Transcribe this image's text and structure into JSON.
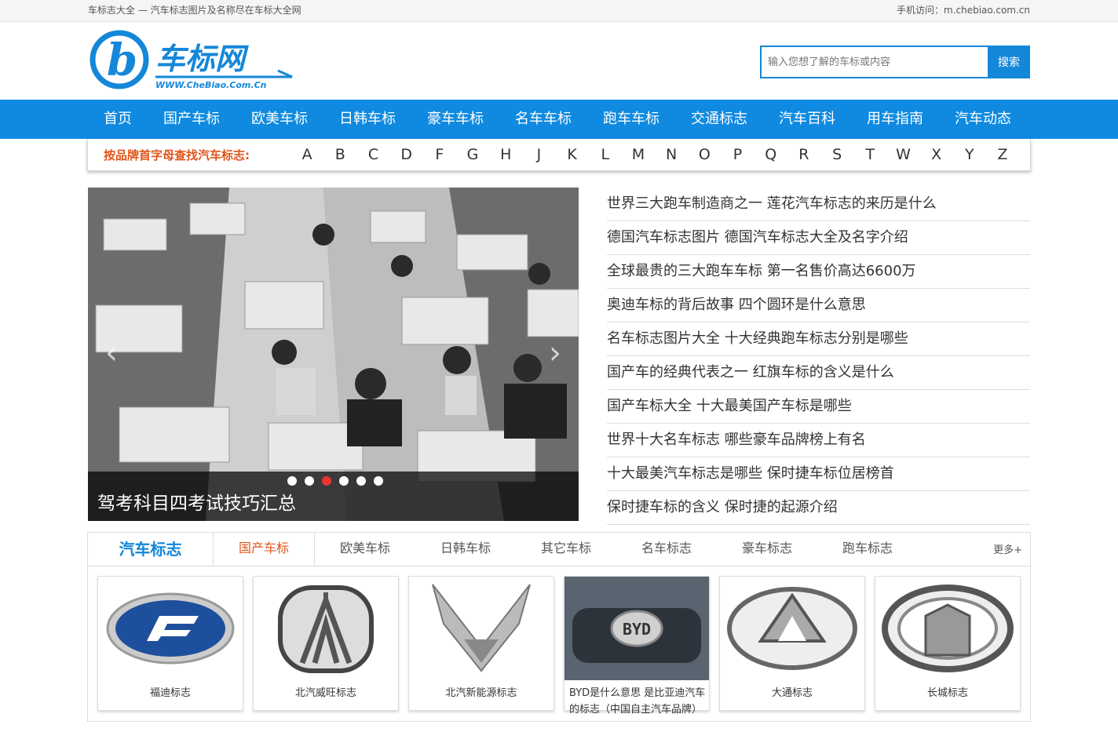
{
  "topbar": {
    "left": "车标志大全 — 汽车标志图片及名称尽在车标大全网",
    "right": "手机访问：m.chebiao.com.cn"
  },
  "logo": {
    "text": "车标网",
    "url": "WWW.CheBiao.Com.Cn"
  },
  "search": {
    "placeholder": "输入您想了解的车标或内容",
    "button": "搜索"
  },
  "nav": [
    "首页",
    "国产车标",
    "欧美车标",
    "日韩车标",
    "豪车车标",
    "名车车标",
    "跑车车标",
    "交通标志",
    "汽车百科",
    "用车指南",
    "汽车动态"
  ],
  "letters": {
    "label": "按品牌首字母查找汽车标志:",
    "items": [
      "A",
      "B",
      "C",
      "D",
      "F",
      "G",
      "H",
      "J",
      "K",
      "L",
      "M",
      "N",
      "O",
      "P",
      "Q",
      "R",
      "S",
      "T",
      "W",
      "X",
      "Y",
      "Z"
    ]
  },
  "slider": {
    "caption": "驾考科目四考试技巧汇总",
    "dots": 6,
    "active_dot": 3
  },
  "news": [
    "世界三大跑车制造商之一 莲花汽车标志的来历是什么",
    "德国汽车标志图片 德国汽车标志大全及名字介绍",
    "全球最贵的三大跑车车标 第一名售价高达6600万",
    "奥迪车标的背后故事 四个圆环是什么意思",
    "名车标志图片大全 十大经典跑车标志分别是哪些",
    "国产车的经典代表之一 红旗车标的含义是什么",
    "国产车标大全 十大最美国产车标是哪些",
    "世界十大名车标志 哪些豪车品牌榜上有名",
    "十大最美汽车标志是哪些 保时捷车标位居榜首",
    "保时捷车标的含义 保时捷的起源介绍"
  ],
  "brand": {
    "title": "汽车标志",
    "tabs": [
      "国产车标",
      "欧美车标",
      "日韩车标",
      "其它车标",
      "名车标志",
      "豪车标志",
      "跑车标志"
    ],
    "more": "更多+",
    "cards": [
      "福迪标志",
      "北汽威旺标志",
      "北汽新能源标志",
      "BYD是什么意思 是比亚迪汽车的标志（中国自主汽车品牌）",
      "大通标志",
      "长城标志"
    ],
    "byd_badge": "BYD"
  },
  "colors": {
    "accent": "#0f8ae0",
    "highlight": "#e0541a"
  }
}
